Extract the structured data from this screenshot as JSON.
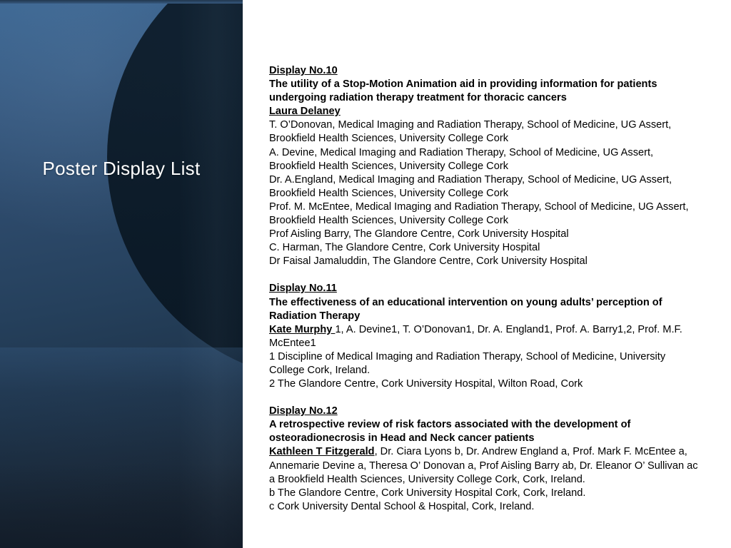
{
  "slide": {
    "title_panel": {
      "title": "Poster Display List"
    }
  },
  "colors": {
    "panel_top": "#3c6692",
    "panel_mid": "#2d4a6b",
    "panel_bottom": "#1a2736",
    "circle_dark": "#0b1a27",
    "crescent_light": "#26415c",
    "content_text": "#000000",
    "background": "#ffffff"
  },
  "content": {
    "blocks": [
      {
        "display_no": "Display No.10",
        "title": "The utility of a Stop-Motion Animation aid in providing information for patients undergoing radiation therapy treatment for thoracic cancers",
        "presenter": "Laura Delaney",
        "authors": [
          "T. O’Donovan, Medical Imaging and Radiation Therapy, School of Medicine, UG Assert, Brookfield Health Sciences, University College Cork",
          "A. Devine, Medical Imaging and Radiation Therapy, School of Medicine, UG Assert, Brookfield Health Sciences, University College Cork",
          "Dr. A.England, Medical Imaging and Radiation Therapy, School of Medicine, UG Assert, Brookfield Health Sciences, University College Cork",
          "Prof. M. McEntee, Medical Imaging and Radiation Therapy, School of Medicine, UG Assert, Brookfield Health Sciences, University College Cork",
          "Prof Aisling Barry, The Glandore Centre, Cork University Hospital",
          "C. Harman, The Glandore Centre, Cork University Hospital",
          "Dr Faisal Jamaluddin, The Glandore Centre, Cork University Hospital"
        ],
        "affiliations": []
      },
      {
        "display_no": "Display No.11",
        "title": "The effectiveness of an educational intervention on young adults’ perception of Radiation Therapy",
        "presenter": " Kate Murphy ",
        "author_remainder": "1,  A. Devine1, T. O’Donovan1, Dr. A. England1, Prof. A. Barry1,2, Prof. M.F. McEntee1",
        "authors": [],
        "affiliations": [
          "1 Discipline of Medical Imaging and Radiation Therapy, School of Medicine, University College Cork, Ireland.",
          "2 The Glandore Centre, Cork University Hospital, Wilton Road, Cork"
        ]
      },
      {
        "display_no": "Display No.12",
        "title": "A retrospective review of risk factors associated with the development of osteoradionecrosis in Head and Neck cancer patients",
        "presenter": "Kathleen T Fitzgerald",
        "author_remainder": ", Dr. Ciara Lyons b, Dr. Andrew England a, Prof. Mark F. McEntee a, Annemarie Devine a, Theresa O’ Donovan a, Prof Aisling Barry ab, Dr. Eleanor O’ Sullivan ac",
        "authors": [],
        "affiliations": [
          "a Brookfield Health Sciences, University College Cork, Cork, Ireland.",
          "b The Glandore Centre, Cork University Hospital Cork, Cork, Ireland.",
          "c Cork University Dental School & Hospital, Cork, Ireland."
        ]
      }
    ]
  }
}
